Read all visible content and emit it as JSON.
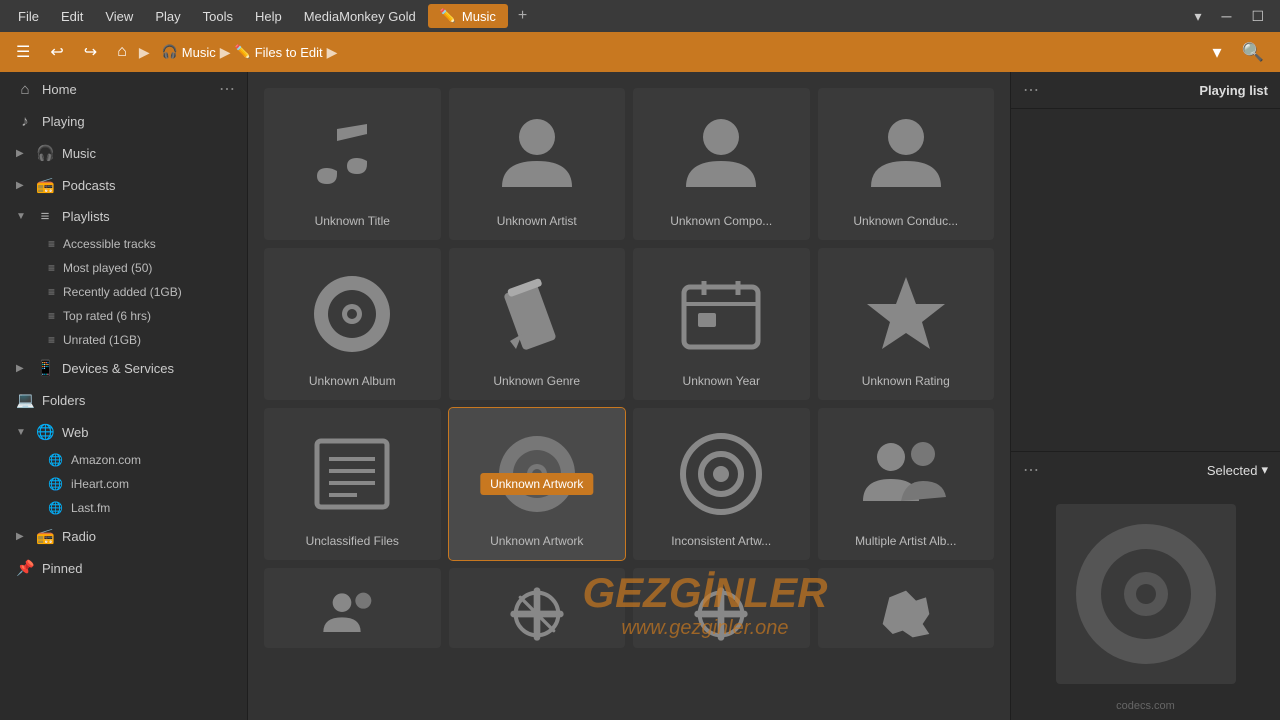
{
  "titleBar": {
    "menus": [
      "File",
      "Edit",
      "View",
      "Play",
      "Tools",
      "Help",
      "MediaMonkey Gold"
    ],
    "activeTab": {
      "label": "Music",
      "icon": "✏️"
    },
    "addTab": "+",
    "winControls": [
      "▾",
      "─",
      "☐"
    ]
  },
  "toolbar": {
    "buttons": [
      "☰",
      "↩",
      "↪",
      "⌂",
      "▶",
      "🎧",
      "✏️"
    ],
    "breadcrumb": [
      {
        "label": "Music",
        "icon": "🎧"
      },
      {
        "label": "Files to Edit",
        "icon": "✏️"
      }
    ],
    "filterIcon": "▾",
    "searchIcon": "🔍"
  },
  "sidebar": {
    "items": [
      {
        "id": "home",
        "label": "Home",
        "icon": "⌂",
        "expandable": false
      },
      {
        "id": "playing",
        "label": "Playing",
        "icon": "♪",
        "expandable": false
      },
      {
        "id": "music",
        "label": "Music",
        "icon": "🎧",
        "expandable": true
      },
      {
        "id": "podcasts",
        "label": "Podcasts",
        "icon": "📻",
        "expandable": true
      },
      {
        "id": "playlists",
        "label": "Playlists",
        "icon": "≡",
        "expandable": true,
        "expanded": true
      },
      {
        "id": "accessible-tracks",
        "label": "Accessible tracks",
        "icon": "≡",
        "sub": true
      },
      {
        "id": "most-played",
        "label": "Most played (50)",
        "icon": "≡",
        "sub": true
      },
      {
        "id": "recently-added",
        "label": "Recently added (1GB)",
        "icon": "≡",
        "sub": true
      },
      {
        "id": "top-rated",
        "label": "Top rated (6 hrs)",
        "icon": "≡",
        "sub": true
      },
      {
        "id": "unrated",
        "label": "Unrated (1GB)",
        "icon": "≡",
        "sub": true
      },
      {
        "id": "devices",
        "label": "Devices & Services",
        "icon": "📱",
        "expandable": true
      },
      {
        "id": "folders",
        "label": "Folders",
        "icon": "💻",
        "expandable": false
      },
      {
        "id": "web",
        "label": "Web",
        "icon": "🌐",
        "expandable": true,
        "expanded": true
      },
      {
        "id": "amazon",
        "label": "Amazon.com",
        "icon": "🌐",
        "sub": true
      },
      {
        "id": "iheart",
        "label": "iHeart.com",
        "icon": "🌐",
        "sub": true
      },
      {
        "id": "lastfm",
        "label": "Last.fm",
        "icon": "🌐",
        "sub": true
      },
      {
        "id": "radio",
        "label": "Radio",
        "icon": "📻",
        "expandable": true
      },
      {
        "id": "pinned",
        "label": "Pinned",
        "icon": "📌",
        "expandable": false
      }
    ],
    "moreButton": "⋯"
  },
  "content": {
    "gridItems": [
      {
        "id": "unknown-title",
        "label": "Unknown Title",
        "iconType": "music-note",
        "selected": false,
        "tooltip": null
      },
      {
        "id": "unknown-artist",
        "label": "Unknown Artist",
        "iconType": "person",
        "selected": false,
        "tooltip": null
      },
      {
        "id": "unknown-composer",
        "label": "Unknown Compo...",
        "iconType": "person",
        "selected": false,
        "tooltip": null
      },
      {
        "id": "unknown-conductor",
        "label": "Unknown Conduc...",
        "iconType": "person",
        "selected": false,
        "tooltip": null
      },
      {
        "id": "unknown-album",
        "label": "Unknown Album",
        "iconType": "disc",
        "selected": false,
        "tooltip": null
      },
      {
        "id": "unknown-genre",
        "label": "Unknown Genre",
        "iconType": "pencil",
        "selected": false,
        "tooltip": null
      },
      {
        "id": "unknown-year",
        "label": "Unknown Year",
        "iconType": "calendar",
        "selected": false,
        "tooltip": null
      },
      {
        "id": "unknown-rating",
        "label": "Unknown Rating",
        "iconType": "star",
        "selected": false,
        "tooltip": null
      },
      {
        "id": "unclassified-files",
        "label": "Unclassified Files",
        "iconType": "lines",
        "selected": false,
        "tooltip": null
      },
      {
        "id": "unknown-artwork",
        "label": "Unknown Artwork",
        "iconType": "disc-small",
        "selected": true,
        "tooltip": "Unknown Artwork"
      },
      {
        "id": "inconsistent-artwork",
        "label": "Inconsistent Artw...",
        "iconType": "disc-outline",
        "selected": false,
        "tooltip": null
      },
      {
        "id": "multiple-artist",
        "label": "Multiple Artist Alb...",
        "iconType": "people",
        "selected": false,
        "tooltip": null
      }
    ]
  },
  "rightPanel": {
    "topTitle": "Playing list",
    "bottomTitle": "Selected",
    "dropdownLabel": "Selected",
    "albumArtLabel": "codecs.com"
  },
  "icons": {
    "colors": {
      "iconFill": "#888888",
      "accent": "#c87820"
    }
  }
}
